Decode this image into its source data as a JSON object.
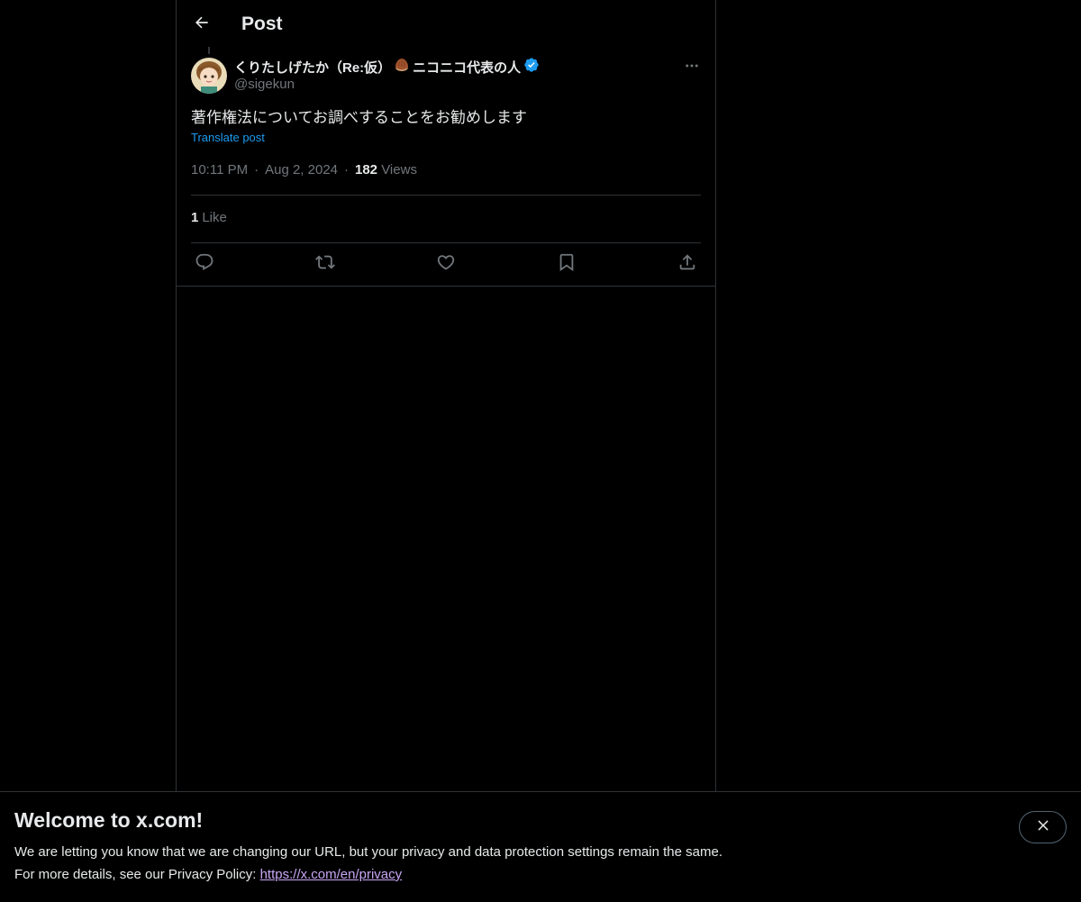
{
  "header": {
    "title": "Post",
    "back_icon": "arrow-left-icon"
  },
  "post": {
    "author": {
      "name": "くりたしげたか（Re:仮）",
      "name_suffix": "ニコニコ代表の人",
      "emoji_icon": "chestnut-icon",
      "verified_icon": "verified-badge-icon",
      "handle": "@sigekun"
    },
    "text": "著作権法についてお調べすることをお勧めします",
    "translate_label": "Translate post",
    "time": "10:11 PM",
    "date": "Aug 2, 2024",
    "views_count": "182",
    "views_label": "Views",
    "likes_count": "1",
    "likes_label": "Like",
    "actions": [
      "reply-icon",
      "repost-icon",
      "like-icon",
      "bookmark-icon",
      "share-icon"
    ]
  },
  "banner": {
    "title": "Welcome to x.com!",
    "line1": "We are letting you know that we are changing our URL, but your privacy and data protection settings remain the same.",
    "line2_prefix": "For more details, see our Privacy Policy: ",
    "link": "https://x.com/en/privacy",
    "close_icon": "close-icon"
  },
  "colors": {
    "background": "#000000",
    "text": "#e7e9ea",
    "muted": "#71767b",
    "accent": "#1d9bf0",
    "verified": "#1d9bf0",
    "border": "#2f3336"
  }
}
